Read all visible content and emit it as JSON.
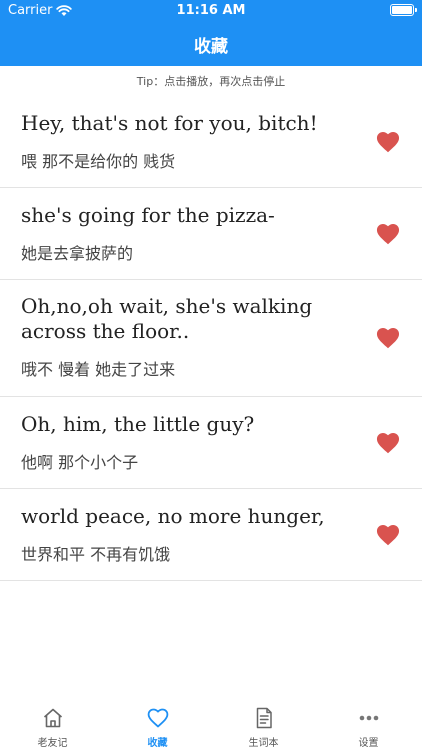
{
  "status_bar": {
    "carrier": "Carrier",
    "time": "11:16 AM"
  },
  "header": {
    "title": "收藏"
  },
  "tip": "Tip：点击播放，再次点击停止",
  "favorites": [
    {
      "en": "Hey, that's not for you, bitch!",
      "cn": "喂  那不是给你的  贱货"
    },
    {
      "en": "she's going for the pizza-",
      "cn": "她是去拿披萨的"
    },
    {
      "en": "Oh,no,oh wait, she's walking across the floor..",
      "cn": "哦不  慢着  她走了过来"
    },
    {
      "en": "Oh, him, the little guy?",
      "cn": "他啊  那个小个子"
    },
    {
      "en": "world peace, no more hunger,",
      "cn": "世界和平  不再有饥饿"
    }
  ],
  "tabs": [
    {
      "label": "老友记",
      "icon": "home-icon"
    },
    {
      "label": "收藏",
      "icon": "heart-outline-icon"
    },
    {
      "label": "生词本",
      "icon": "notebook-icon"
    },
    {
      "label": "设置",
      "icon": "more-icon"
    }
  ],
  "colors": {
    "accent": "#1e90f4",
    "heart": "#d9534f",
    "divider": "#e3e3e3"
  }
}
